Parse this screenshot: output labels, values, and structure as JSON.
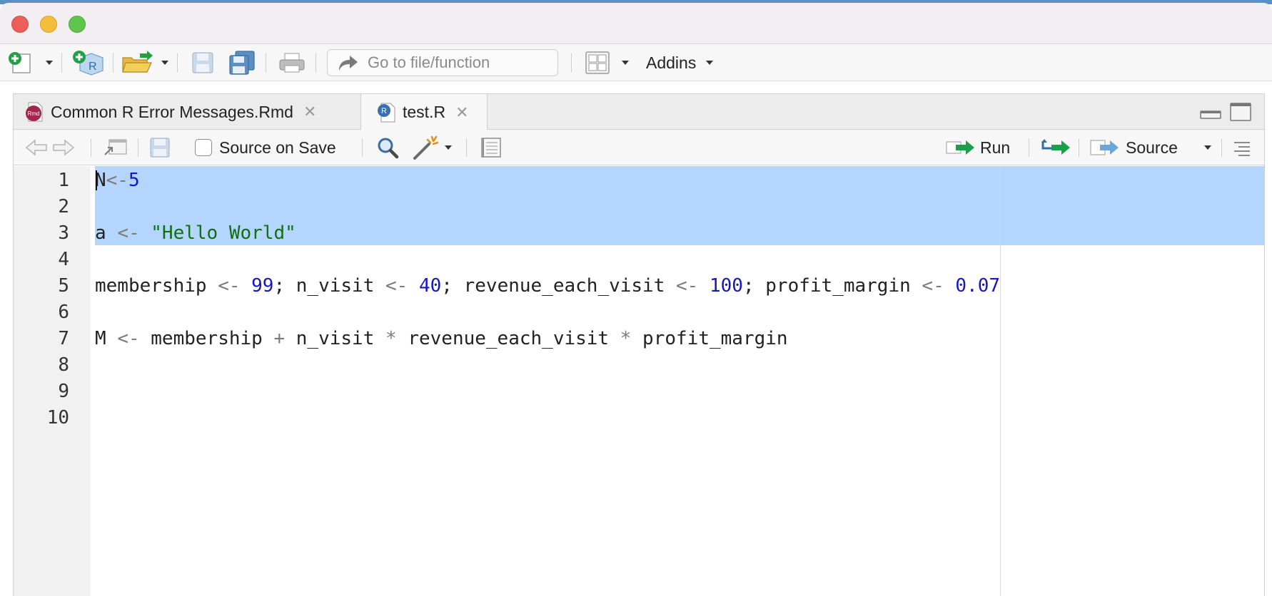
{
  "window": {
    "controls": [
      "close",
      "minimize",
      "maximize"
    ]
  },
  "toolbar": {
    "goto_placeholder": "Go to file/function",
    "addins_label": "Addins",
    "icons": [
      "new-file-icon",
      "new-project-icon",
      "open-folder-icon",
      "save-icon",
      "save-all-icon",
      "print-icon",
      "go-to-arrow-icon",
      "workspace-panes-icon"
    ]
  },
  "tabs": [
    {
      "label": "Common R Error Messages.Rmd",
      "icon": "rmd-file-icon",
      "badge": "Rmd",
      "active": false
    },
    {
      "label": "test.R",
      "icon": "r-file-icon",
      "badge": "R",
      "active": true
    }
  ],
  "editor_toolbar": {
    "source_on_save_label": "Source on Save",
    "source_on_save_checked": false,
    "run_label": "Run",
    "source_label": "Source"
  },
  "code": {
    "line_numbers": [
      "1",
      "2",
      "3",
      "4",
      "5",
      "6",
      "7",
      "8",
      "9",
      "10"
    ],
    "selected_lines": [
      1,
      2,
      3
    ],
    "lines": [
      [
        {
          "t": "N",
          "k": "id"
        },
        {
          "t": "<-",
          "k": "op"
        },
        {
          "t": "5",
          "k": "num"
        }
      ],
      [],
      [
        {
          "t": "a ",
          "k": "id"
        },
        {
          "t": "<-",
          "k": "op"
        },
        {
          "t": " ",
          "k": "id"
        },
        {
          "t": "\"Hello World\"",
          "k": "str"
        }
      ],
      [],
      [
        {
          "t": "membership ",
          "k": "id"
        },
        {
          "t": "<-",
          "k": "op"
        },
        {
          "t": " ",
          "k": "id"
        },
        {
          "t": "99",
          "k": "num"
        },
        {
          "t": "; n_visit ",
          "k": "id"
        },
        {
          "t": "<-",
          "k": "op"
        },
        {
          "t": " ",
          "k": "id"
        },
        {
          "t": "40",
          "k": "num"
        },
        {
          "t": "; revenue_each_visit ",
          "k": "id"
        },
        {
          "t": "<-",
          "k": "op"
        },
        {
          "t": " ",
          "k": "id"
        },
        {
          "t": "100",
          "k": "num"
        },
        {
          "t": "; profit_margin ",
          "k": "id"
        },
        {
          "t": "<-",
          "k": "op"
        },
        {
          "t": " ",
          "k": "id"
        },
        {
          "t": "0.07",
          "k": "num"
        }
      ],
      [],
      [
        {
          "t": "M ",
          "k": "id"
        },
        {
          "t": "<-",
          "k": "op"
        },
        {
          "t": " membership ",
          "k": "id"
        },
        {
          "t": "+",
          "k": "op"
        },
        {
          "t": " n_visit ",
          "k": "id"
        },
        {
          "t": "*",
          "k": "op"
        },
        {
          "t": " revenue_each_visit ",
          "k": "id"
        },
        {
          "t": "*",
          "k": "op"
        },
        {
          "t": " profit_margin",
          "k": "id"
        }
      ],
      [],
      [],
      []
    ]
  },
  "colors": {
    "selection": "#b4d5fd",
    "number": "#1616c8",
    "string": "#107010",
    "operator": "#7b7b7b",
    "run_arrow": "#1aa04a"
  }
}
